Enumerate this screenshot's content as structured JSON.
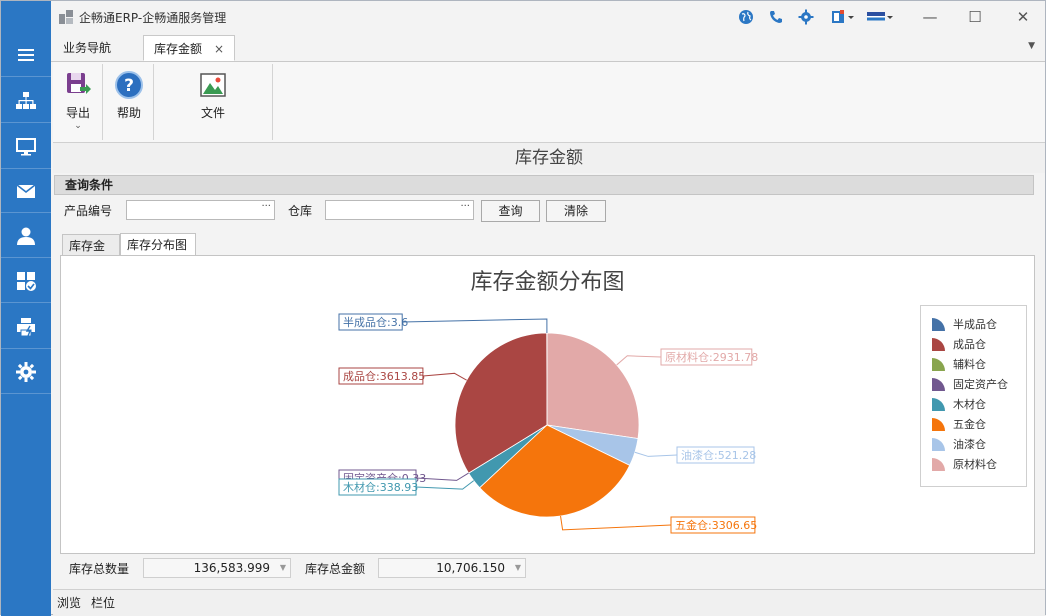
{
  "window": {
    "title": "企畅通ERP-企畅通服务管理"
  },
  "tabs": [
    {
      "label": "业务导航"
    },
    {
      "label": "库存金额",
      "close": "×"
    }
  ],
  "ribbon": {
    "export_label": "导出",
    "help_label": "帮助",
    "file_label": "文件"
  },
  "page_title": "库存金额",
  "query": {
    "header": "查询条件",
    "product_label": "产品编号",
    "product_value": "",
    "warehouse_label": "仓库",
    "warehouse_value": "",
    "ellipsis": "···",
    "search_button": "查询",
    "clear_button": "清除"
  },
  "inner_tabs": [
    {
      "label": "库存金额"
    },
    {
      "label": "库存分布图"
    }
  ],
  "chart_data": {
    "type": "pie",
    "title": "库存金额分布图",
    "legend_position": "right",
    "categories": [
      "半成品仓",
      "成品仓",
      "辅料仓",
      "固定资产仓",
      "木材仓",
      "五金仓",
      "油漆仓",
      "原材料仓"
    ],
    "values": [
      3.6,
      3613.85,
      0,
      0.33,
      338.93,
      3306.65,
      521.28,
      2931.78
    ],
    "colors": [
      "#4572a7",
      "#aa4643",
      "#89a54e",
      "#71588f",
      "#4198af",
      "#f5750c",
      "#a8c5e8",
      "#e2a9a8"
    ],
    "data_labels": [
      "半成品仓:3.6",
      "成品仓:3613.85",
      "固定资产仓:0.33",
      "木材仓:338.93",
      "五金仓:3306.65",
      "油漆仓:521.28",
      "原材料仓:2931.78"
    ]
  },
  "summary": {
    "qty_label": "库存总数量",
    "qty_value": "136,583.999",
    "amount_label": "库存总金额",
    "amount_value": "10,706.150"
  },
  "status": {
    "browse": "浏览",
    "column": "栏位"
  }
}
